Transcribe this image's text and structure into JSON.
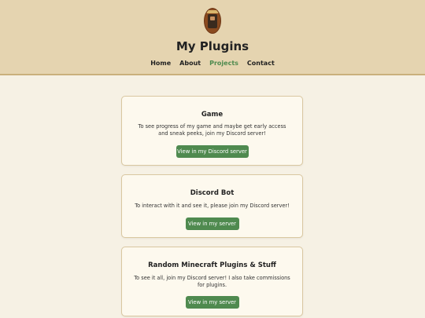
{
  "header": {
    "title": "My Plugins",
    "logo_icon": "character-portrait-icon",
    "background": "#e5d4b0"
  },
  "nav": {
    "items": [
      {
        "label": "Home"
      },
      {
        "label": "About"
      },
      {
        "label": "Projects",
        "active": true
      },
      {
        "label": "Contact"
      }
    ],
    "active_color": "#4e8a4e"
  },
  "projects": [
    {
      "title": "Game",
      "description": "To see progress of my game and maybe get early access and sneak peeks, join my Discord server!",
      "button_label": "View in my Discord server"
    },
    {
      "title": "Discord Bot",
      "description": "To interact with it and see it, please join my Discord server!",
      "button_label": "View in my server"
    },
    {
      "title": "Random Minecraft Plugins & Stuff",
      "description": "To see it all, join my Discord server! I also take commissions for plugins.",
      "button_label": "View in my server"
    }
  ],
  "colors": {
    "page_background": "#f6f1e4",
    "button": "#4f8a4f"
  }
}
